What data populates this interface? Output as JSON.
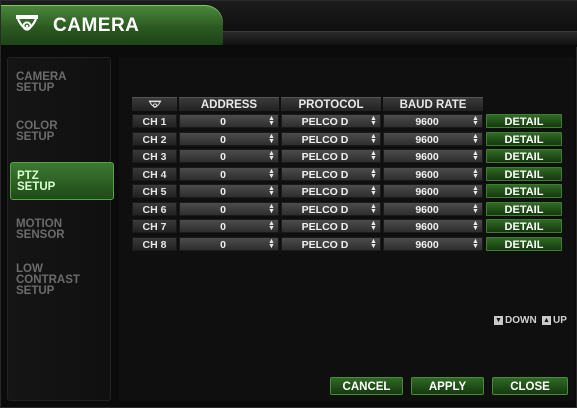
{
  "window": {
    "title": "CAMERA"
  },
  "sidebar": {
    "items": [
      {
        "label": "CAMERA SETUP",
        "active": false
      },
      {
        "label": "COLOR SETUP",
        "active": false
      },
      {
        "label": "PTZ SETUP",
        "active": true
      },
      {
        "label": "MOTION SENSOR",
        "active": false
      },
      {
        "label": "LOW CONTRAST SETUP",
        "active": false
      }
    ]
  },
  "table": {
    "headers": {
      "icon": "camera-icon",
      "address": "ADDRESS",
      "protocol": "PROTOCOL",
      "baud_rate": "BAUD RATE"
    },
    "rows": [
      {
        "channel": "CH 1",
        "address": "0",
        "protocol": "PELCO  D",
        "baud_rate": "9600",
        "action": "DETAIL"
      },
      {
        "channel": "CH 2",
        "address": "0",
        "protocol": "PELCO  D",
        "baud_rate": "9600",
        "action": "DETAIL"
      },
      {
        "channel": "CH 3",
        "address": "0",
        "protocol": "PELCO  D",
        "baud_rate": "9600",
        "action": "DETAIL"
      },
      {
        "channel": "CH 4",
        "address": "0",
        "protocol": "PELCO  D",
        "baud_rate": "9600",
        "action": "DETAIL"
      },
      {
        "channel": "CH 5",
        "address": "0",
        "protocol": "PELCO  D",
        "baud_rate": "9600",
        "action": "DETAIL"
      },
      {
        "channel": "CH 6",
        "address": "0",
        "protocol": "PELCO  D",
        "baud_rate": "9600",
        "action": "DETAIL"
      },
      {
        "channel": "CH 7",
        "address": "0",
        "protocol": "PELCO  D",
        "baud_rate": "9600",
        "action": "DETAIL"
      },
      {
        "channel": "CH 8",
        "address": "0",
        "protocol": "PELCO  D",
        "baud_rate": "9600",
        "action": "DETAIL"
      }
    ]
  },
  "pager": {
    "down_label": "DOWN",
    "up_label": "UP"
  },
  "footer": {
    "cancel_label": "CANCEL",
    "apply_label": "APPLY",
    "close_label": "CLOSE"
  },
  "colors": {
    "accent_green": "#2f6a24",
    "active_text": "#d8ffd0",
    "background": "#0b0b0b"
  }
}
